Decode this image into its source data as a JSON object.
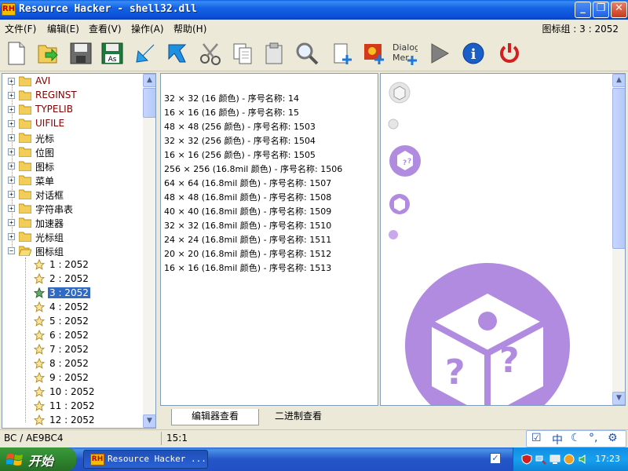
{
  "window": {
    "title": "Resource Hacker - shell32.dll",
    "app_icon_text": "RH"
  },
  "menu": {
    "items": [
      {
        "label": "文件(F)"
      },
      {
        "label": "编辑(E)"
      },
      {
        "label": "查看(V)"
      },
      {
        "label": "操作(A)"
      },
      {
        "label": "帮助(H)"
      }
    ],
    "status": "图标组 : 3 : 2052"
  },
  "toolbar": {
    "dialog_label": "Dialog\nMer+",
    "as_label": "As"
  },
  "tree": {
    "folders": [
      {
        "label": "AVI",
        "color": "#800000"
      },
      {
        "label": "REGINST",
        "color": "#800000"
      },
      {
        "label": "TYPELIB",
        "color": "#800000"
      },
      {
        "label": "UIFILE",
        "color": "#800000"
      },
      {
        "label": "光标",
        "color": "#000000"
      },
      {
        "label": "位图",
        "color": "#000000"
      },
      {
        "label": "图标",
        "color": "#000000"
      },
      {
        "label": "菜单",
        "color": "#000000"
      },
      {
        "label": "对话框",
        "color": "#000000"
      },
      {
        "label": "字符串表",
        "color": "#000000"
      },
      {
        "label": "加速器",
        "color": "#000000"
      },
      {
        "label": "光标组",
        "color": "#000000"
      },
      {
        "label": "图标组",
        "color": "#000000"
      }
    ],
    "children": [
      {
        "label": "1 : 2052"
      },
      {
        "label": "2 : 2052"
      },
      {
        "label": "3 : 2052",
        "selected": true
      },
      {
        "label": "4 : 2052"
      },
      {
        "label": "5 : 2052"
      },
      {
        "label": "6 : 2052"
      },
      {
        "label": "7 : 2052"
      },
      {
        "label": "8 : 2052"
      },
      {
        "label": "9 : 2052"
      },
      {
        "label": "10 : 2052"
      },
      {
        "label": "11 : 2052"
      },
      {
        "label": "12 : 2052"
      }
    ]
  },
  "editor": {
    "lines": [
      "32 × 32 (16 颜色) - 序号名称: 14",
      "16 × 16 (16 颜色) - 序号名称: 15",
      "48 × 48 (256 颜色) - 序号名称: 1503",
      "32 × 32 (256 颜色) - 序号名称: 1504",
      "16 × 16 (256 颜色) - 序号名称: 1505",
      "256 × 256 (16.8mil 颜色) - 序号名称: 1506",
      "64 × 64 (16.8mil 颜色) - 序号名称: 1507",
      "48 × 48 (16.8mil 颜色) - 序号名称: 1508",
      "40 × 40 (16.8mil 颜色) - 序号名称: 1509",
      "32 × 32 (16.8mil 颜色) - 序号名称: 1510",
      "24 × 24 (16.8mil 颜色) - 序号名称: 1511",
      "20 × 20 (16.8mil 颜色) - 序号名称: 1512",
      "16 × 16 (16.8mil 颜色) - 序号名称: 1513"
    ]
  },
  "tabs": [
    {
      "label": "编辑器查看",
      "active": true
    },
    {
      "label": "二进制查看",
      "active": false
    }
  ],
  "statusbar": {
    "left": "BC / AE9BC4",
    "position": "15:1"
  },
  "language_bar": {
    "ime": "中"
  },
  "taskbar": {
    "start_label": "开始",
    "task_label": "Resource Hacker ...",
    "clock": "17:23"
  },
  "colors": {
    "icon_purple": "#b08be0",
    "icon_purple_light": "#c9a8ee",
    "selection": "#316ac5",
    "tree_special_text": "#800000"
  }
}
